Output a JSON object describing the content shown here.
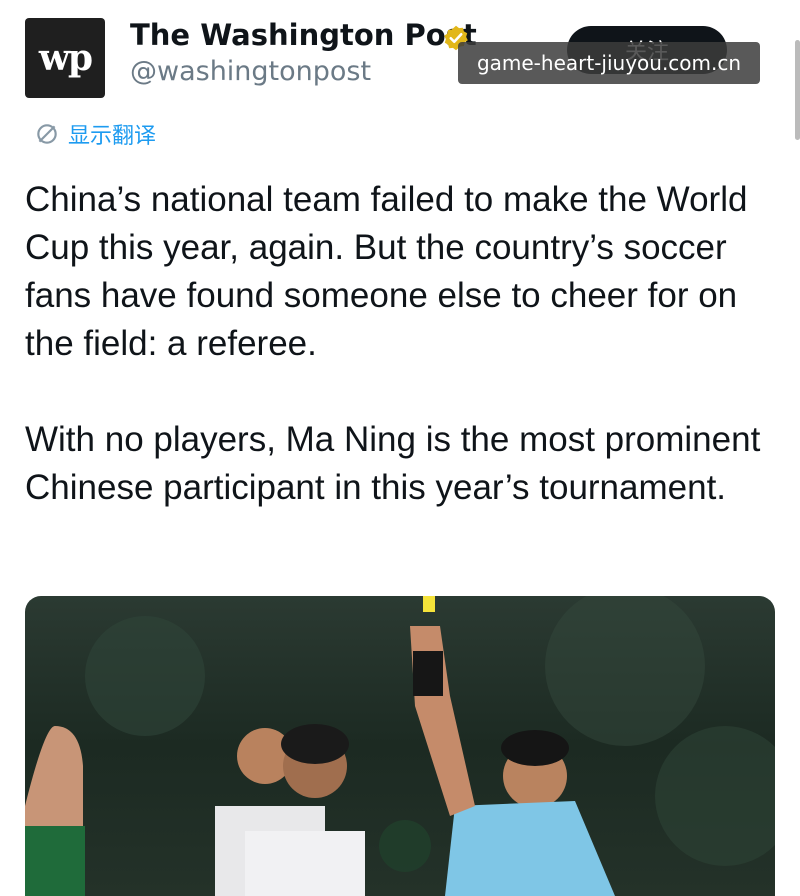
{
  "author": {
    "avatar_text": "wp",
    "name": "The Washington Post",
    "handle": "@washingtonpost",
    "verified_icon": "gold-verified-badge",
    "verified_color": "#e2b719"
  },
  "follow_button": {
    "label": "关注"
  },
  "watermark": "game-heart-jiuyou.com.cn",
  "translate_link": {
    "icon": "translate-icon",
    "label": "显示翻译"
  },
  "tweet": {
    "paragraphs": [
      "China’s national team failed to make the World Cup this year, again. But the country’s soccer fans have found someone else to cheer for on the field: a referee.",
      "With no players, Ma Ning is the most prominent Chinese participant in this year’s tournament."
    ]
  },
  "media": {
    "alt": "Referee Ma Ning raising a yellow card during a match"
  },
  "colors": {
    "accent": "#1d9bf0",
    "text": "#0f1419",
    "secondary": "#6b7a86"
  }
}
